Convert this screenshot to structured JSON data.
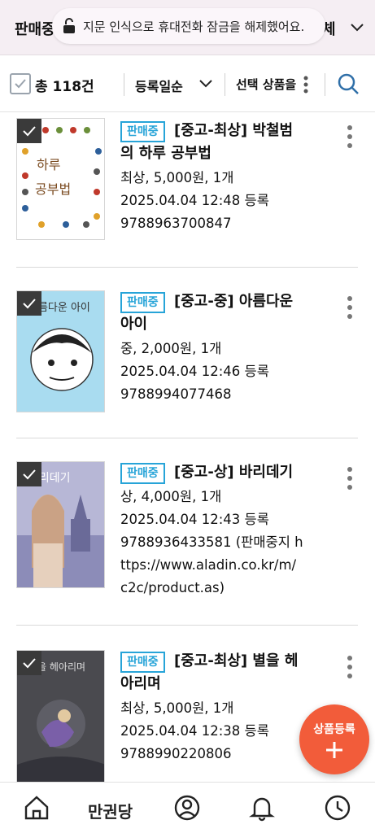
{
  "topbar": {
    "left_label": "판매중",
    "right_label": "체",
    "toast_message": "지문 인식으로 휴대전화 잠금을 해제했어요."
  },
  "filter": {
    "total": "총 118건",
    "sort_label": "등록일순",
    "select_goods_label": "선택 상품을"
  },
  "items": [
    {
      "badge": "판매중",
      "title_line1": "[중고-최상] 박철범",
      "title_line2": "의 하루 공부법",
      "condition_price": "최상, 5,000원, 1개",
      "registered": "2025.04.04 12:48 등록",
      "isbn_lines": [
        "9788963700847"
      ],
      "cover_color": "#ffffff"
    },
    {
      "badge": "판매중",
      "title_line1": "[중고-중] 아름다운",
      "title_line2": "아이",
      "condition_price": "중, 2,000원, 1개",
      "registered": "2025.04.04 12:46 등록",
      "isbn_lines": [
        "9788994077468"
      ],
      "cover_color": "#a9dcf0"
    },
    {
      "badge": "판매중",
      "title_line1": "[중고-상] 바리데기",
      "title_line2": "",
      "condition_price": "상, 4,000원, 1개",
      "registered": "2025.04.04 12:43 등록",
      "isbn_lines": [
        "9788936433581 (판매중지 h",
        "ttps://www.aladin.co.kr/m/",
        "c2c/product.as)"
      ],
      "cover_color": "#b7b7d6"
    },
    {
      "badge": "판매중",
      "title_line1": "[중고-최상] 별을 헤",
      "title_line2": "아리며",
      "condition_price": "최상, 5,000원, 1개",
      "registered": "2025.04.04 12:38 등록",
      "isbn_lines": [
        "9788990220806"
      ],
      "cover_color": "#4a4a4f"
    }
  ],
  "fab": {
    "label": "상품등록"
  },
  "bottom_nav": {
    "title": "만권당"
  },
  "colors": {
    "accent": "#27a4d8",
    "fab": "#f25c3a",
    "topbar": "#f5eef3"
  }
}
